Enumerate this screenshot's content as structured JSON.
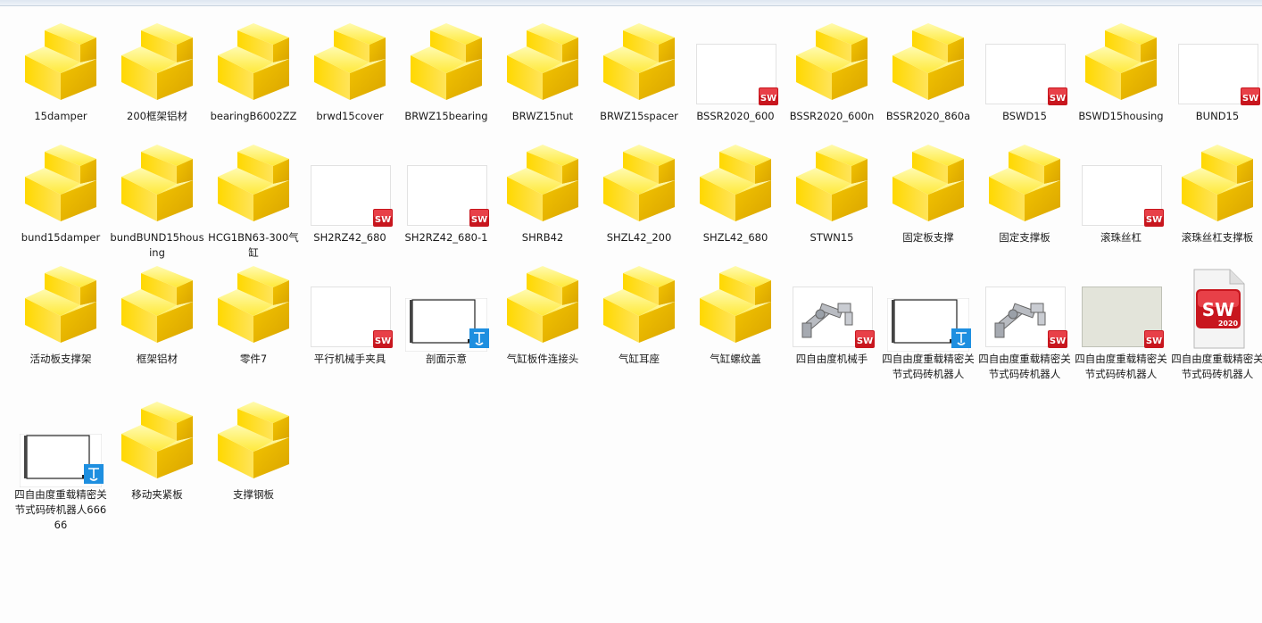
{
  "explorer": {
    "items": [
      {
        "name": "15damper",
        "kind": "assembly"
      },
      {
        "name": "200框架铝材",
        "kind": "assembly"
      },
      {
        "name": "bearingB6002ZZ",
        "kind": "assembly"
      },
      {
        "name": "brwd15cover",
        "kind": "assembly"
      },
      {
        "name": "BRWZ15bearing",
        "kind": "assembly"
      },
      {
        "name": "BRWZ15nut",
        "kind": "assembly"
      },
      {
        "name": "BRWZ15spacer",
        "kind": "assembly"
      },
      {
        "name": "BSSR2020_600",
        "kind": "sw-part-blank"
      },
      {
        "name": "BSSR2020_600n",
        "kind": "assembly"
      },
      {
        "name": "BSSR2020_860a",
        "kind": "assembly"
      },
      {
        "name": "BSWD15",
        "kind": "sw-part-blank"
      },
      {
        "name": "BSWD15housing",
        "kind": "assembly"
      },
      {
        "name": "BUND15",
        "kind": "sw-part-blank"
      },
      {
        "name": "bund15damper",
        "kind": "assembly"
      },
      {
        "name": "bundBUND15housing",
        "kind": "assembly"
      },
      {
        "name": "HCG1BN63-300气缸",
        "kind": "assembly"
      },
      {
        "name": "SH2RZ42_680",
        "kind": "sw-part-blank"
      },
      {
        "name": "SH2RZ42_680-1",
        "kind": "sw-part-blank"
      },
      {
        "name": "SHRB42",
        "kind": "assembly"
      },
      {
        "name": "SHZL42_200",
        "kind": "assembly"
      },
      {
        "name": "SHZL42_680",
        "kind": "assembly"
      },
      {
        "name": "STWN15",
        "kind": "assembly"
      },
      {
        "name": "固定板支撑",
        "kind": "assembly"
      },
      {
        "name": "固定支撑板",
        "kind": "assembly"
      },
      {
        "name": "滚珠丝杠",
        "kind": "sw-part-blank"
      },
      {
        "name": "滚珠丝杠支撑板",
        "kind": "assembly"
      },
      {
        "name": "活动板支撑架",
        "kind": "assembly"
      },
      {
        "name": "框架铝材",
        "kind": "assembly"
      },
      {
        "name": "零件7",
        "kind": "assembly"
      },
      {
        "name": "平行机械手夹具",
        "kind": "sw-part-blank"
      },
      {
        "name": "剖面示意",
        "kind": "drawing"
      },
      {
        "name": "气缸板件连接头",
        "kind": "assembly"
      },
      {
        "name": "气缸耳座",
        "kind": "assembly"
      },
      {
        "name": "气缸螺纹盖",
        "kind": "assembly"
      },
      {
        "name": "四自由度机械手",
        "kind": "sw-robot"
      },
      {
        "name": "四自由度重载精密关节式码砖机器人",
        "kind": "drawing"
      },
      {
        "name": "四自由度重载精密关节式码砖机器人",
        "kind": "sw-robot"
      },
      {
        "name": "四自由度重载精密关节式码砖机器人",
        "kind": "sw-gray"
      },
      {
        "name": "四自由度重载精密关节式码砖机器人",
        "kind": "sw2020"
      },
      {
        "name": "四自由度重载精密关节式码砖机器人66666",
        "kind": "drawing"
      },
      {
        "name": "移动夹紧板",
        "kind": "assembly"
      },
      {
        "name": "支撑钢板",
        "kind": "assembly"
      }
    ],
    "sw2020_text": "2020",
    "sw_text": "SW",
    "colors": {
      "folder": "#f5d400",
      "sw_red": "#d11f26",
      "drw_blue": "#1e8fe0"
    }
  }
}
